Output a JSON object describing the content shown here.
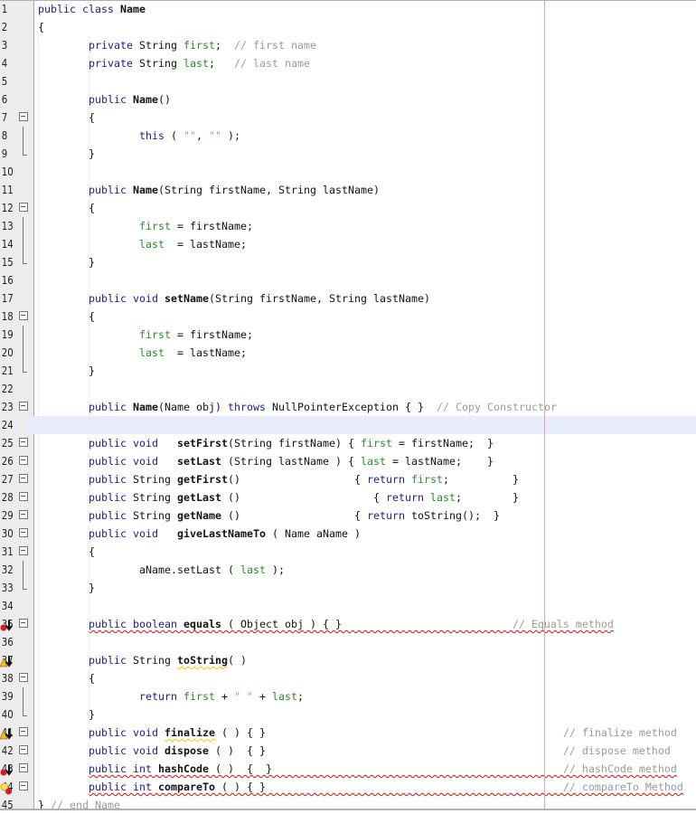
{
  "editor": {
    "current_line": 24,
    "colors": {
      "keyword": "#1c1c8a",
      "field": "#2a8a2a",
      "comment": "#9a9a9a",
      "string": "#c89a4a",
      "margin": "#f0a0a8",
      "current_line": "#e6edf8"
    },
    "lines": [
      {
        "n": "1",
        "tokens": [
          [
            "kw",
            "public class "
          ],
          [
            "bold",
            "Name"
          ]
        ]
      },
      {
        "n": "2",
        "tokens": [
          [
            "",
            "{"
          ]
        ]
      },
      {
        "n": "3",
        "tokens": [
          [
            "",
            "        "
          ],
          [
            "kw",
            "private "
          ],
          [
            "",
            "String "
          ],
          [
            "fld",
            "first"
          ],
          [
            "",
            ";  "
          ],
          [
            "cmt",
            "// first name"
          ]
        ]
      },
      {
        "n": "4",
        "tokens": [
          [
            "",
            "        "
          ],
          [
            "kw",
            "private "
          ],
          [
            "",
            "String "
          ],
          [
            "fld",
            "last"
          ],
          [
            "",
            ";   "
          ],
          [
            "cmt",
            "// last name"
          ]
        ]
      },
      {
        "n": "5",
        "tokens": []
      },
      {
        "n": "6",
        "tokens": [
          [
            "",
            "        "
          ],
          [
            "kw",
            "public "
          ],
          [
            "bold",
            "Name"
          ],
          [
            "",
            "()"
          ]
        ]
      },
      {
        "n": "7",
        "fold": "start",
        "tokens": [
          [
            "",
            "        {"
          ]
        ]
      },
      {
        "n": "8",
        "fold": "mid",
        "tokens": [
          [
            "",
            "                "
          ],
          [
            "kw",
            "this"
          ],
          [
            "",
            " ( "
          ],
          [
            "str",
            "\"\""
          ],
          [
            "",
            ", "
          ],
          [
            "str",
            "\"\""
          ],
          [
            "",
            " );"
          ]
        ]
      },
      {
        "n": "9",
        "fold": "end",
        "tokens": [
          [
            "",
            "        }"
          ]
        ]
      },
      {
        "n": "10",
        "tokens": []
      },
      {
        "n": "11",
        "tokens": [
          [
            "",
            "        "
          ],
          [
            "kw",
            "public "
          ],
          [
            "bold",
            "Name"
          ],
          [
            "",
            "(String firstName, String lastName)"
          ]
        ]
      },
      {
        "n": "12",
        "fold": "start",
        "tokens": [
          [
            "",
            "        {"
          ]
        ]
      },
      {
        "n": "13",
        "fold": "mid",
        "tokens": [
          [
            "",
            "                "
          ],
          [
            "fld",
            "first"
          ],
          [
            "",
            " = firstName;"
          ]
        ]
      },
      {
        "n": "14",
        "fold": "mid",
        "tokens": [
          [
            "",
            "                "
          ],
          [
            "fld",
            "last"
          ],
          [
            "",
            "  = lastName;"
          ]
        ]
      },
      {
        "n": "15",
        "fold": "end",
        "tokens": [
          [
            "",
            "        }"
          ]
        ]
      },
      {
        "n": "16",
        "tokens": []
      },
      {
        "n": "17",
        "tokens": [
          [
            "",
            "        "
          ],
          [
            "kw",
            "public void "
          ],
          [
            "bold",
            "setName"
          ],
          [
            "",
            "(String firstName, String lastName)"
          ]
        ]
      },
      {
        "n": "18",
        "fold": "start",
        "tokens": [
          [
            "",
            "        {"
          ]
        ]
      },
      {
        "n": "19",
        "fold": "mid",
        "tokens": [
          [
            "",
            "                "
          ],
          [
            "fld",
            "first"
          ],
          [
            "",
            " = firstName;"
          ]
        ]
      },
      {
        "n": "20",
        "fold": "mid",
        "tokens": [
          [
            "",
            "                "
          ],
          [
            "fld",
            "last"
          ],
          [
            "",
            "  = lastName;"
          ]
        ]
      },
      {
        "n": "21",
        "fold": "end",
        "tokens": [
          [
            "",
            "        }"
          ]
        ]
      },
      {
        "n": "22",
        "tokens": []
      },
      {
        "n": "23",
        "fold": "start",
        "tokens": [
          [
            "",
            "        "
          ],
          [
            "kw",
            "public "
          ],
          [
            "bold",
            "Name"
          ],
          [
            "",
            "(Name obj) "
          ],
          [
            "kw",
            "throws "
          ],
          [
            "",
            "NullPointerException { }  "
          ],
          [
            "cmt",
            "// Copy Constructor"
          ]
        ]
      },
      {
        "n": "24",
        "tokens": []
      },
      {
        "n": "25",
        "fold": "start",
        "tokens": [
          [
            "",
            "        "
          ],
          [
            "kw",
            "public void   "
          ],
          [
            "bold",
            "setFirst"
          ],
          [
            "",
            "(String firstName) { "
          ],
          [
            "fld",
            "first"
          ],
          [
            "",
            " = firstName;  }"
          ]
        ]
      },
      {
        "n": "26",
        "fold": "start",
        "tokens": [
          [
            "",
            "        "
          ],
          [
            "kw",
            "public void   "
          ],
          [
            "bold",
            "setLast"
          ],
          [
            "",
            " (String lastName ) { "
          ],
          [
            "fld",
            "last"
          ],
          [
            "",
            " = lastName;    }"
          ]
        ]
      },
      {
        "n": "27",
        "fold": "start",
        "tokens": [
          [
            "",
            "        "
          ],
          [
            "kw",
            "public "
          ],
          [
            "",
            "String "
          ],
          [
            "bold",
            "getFirst"
          ],
          [
            "",
            "()                  { "
          ],
          [
            "kw",
            "return "
          ],
          [
            "fld",
            "first"
          ],
          [
            "",
            ";          }"
          ]
        ]
      },
      {
        "n": "28",
        "fold": "start",
        "tokens": [
          [
            "",
            "        "
          ],
          [
            "kw",
            "public "
          ],
          [
            "",
            "String "
          ],
          [
            "bold",
            "getLast"
          ],
          [
            "",
            " ()                     { "
          ],
          [
            "kw",
            "return "
          ],
          [
            "fld",
            "last"
          ],
          [
            "",
            ";        }"
          ]
        ]
      },
      {
        "n": "29",
        "fold": "start",
        "tokens": [
          [
            "",
            "        "
          ],
          [
            "kw",
            "public "
          ],
          [
            "",
            "String "
          ],
          [
            "bold",
            "getName"
          ],
          [
            "",
            " ()                  { "
          ],
          [
            "kw",
            "return "
          ],
          [
            "",
            "toString();  }"
          ]
        ]
      },
      {
        "n": "30",
        "fold": "start",
        "tokens": [
          [
            "",
            "        "
          ],
          [
            "kw",
            "public void   "
          ],
          [
            "bold",
            "giveLastNameTo"
          ],
          [
            "",
            " ( Name aName )"
          ]
        ]
      },
      {
        "n": "31",
        "fold": "start",
        "tokens": [
          [
            "",
            "        {"
          ]
        ]
      },
      {
        "n": "32",
        "fold": "mid",
        "tokens": [
          [
            "",
            "                aName.setLast ( "
          ],
          [
            "fld",
            "last"
          ],
          [
            "",
            " );"
          ]
        ]
      },
      {
        "n": "33",
        "fold": "end",
        "tokens": [
          [
            "",
            "        }"
          ]
        ]
      },
      {
        "n": "34",
        "tokens": []
      },
      {
        "n": "35",
        "fold": "start",
        "marker": "error-override",
        "diag": "error",
        "indent": "        ",
        "tokens": [
          [
            "kw",
            "public boolean "
          ],
          [
            "bold",
            "equals"
          ],
          [
            "",
            " ( Object obj ) { }                           "
          ],
          [
            "cmt",
            "// Equals method"
          ]
        ]
      },
      {
        "n": "36",
        "tokens": []
      },
      {
        "n": "37",
        "marker": "warning-override",
        "tokens": [
          [
            "",
            "        "
          ],
          [
            "kw",
            "public "
          ],
          [
            "",
            "String "
          ],
          [
            "bold warn",
            "toString"
          ],
          [
            "",
            "( )"
          ]
        ]
      },
      {
        "n": "38",
        "fold": "start",
        "tokens": [
          [
            "",
            "        {"
          ]
        ]
      },
      {
        "n": "39",
        "fold": "mid",
        "tokens": [
          [
            "",
            "                "
          ],
          [
            "kw",
            "return "
          ],
          [
            "fld",
            "first"
          ],
          [
            "",
            " + "
          ],
          [
            "str",
            "\" \""
          ],
          [
            "",
            " + "
          ],
          [
            "fld",
            "last"
          ],
          [
            "",
            ";"
          ]
        ]
      },
      {
        "n": "40",
        "fold": "end",
        "tokens": [
          [
            "",
            "        }"
          ]
        ]
      },
      {
        "n": "41",
        "fold": "start",
        "marker": "warning-override",
        "tokens": [
          [
            "",
            "        "
          ],
          [
            "kw",
            "public void "
          ],
          [
            "bold warn",
            "finalize"
          ],
          [
            "",
            " ( ) { }                                               "
          ],
          [
            "cmt",
            "// finalize method"
          ]
        ]
      },
      {
        "n": "42",
        "fold": "start",
        "tokens": [
          [
            "",
            "        "
          ],
          [
            "kw",
            "public void "
          ],
          [
            "bold",
            "dispose"
          ],
          [
            "",
            " ( )  { }                                               "
          ],
          [
            "cmt",
            "// dispose method"
          ]
        ]
      },
      {
        "n": "43",
        "fold": "start",
        "marker": "error-override",
        "diag": "error",
        "indent": "        ",
        "tokens": [
          [
            "kw",
            "public int "
          ],
          [
            "bold",
            "hashCode"
          ],
          [
            "",
            " ( )  {  }                                              "
          ],
          [
            "cmt",
            "// hashCode method"
          ]
        ]
      },
      {
        "n": "44",
        "fold": "start",
        "marker": "bulb-error",
        "diag": "error",
        "indent": "        ",
        "tokens": [
          [
            "kw",
            "public int "
          ],
          [
            "bold",
            "compareTo"
          ],
          [
            "",
            " ( ) { }                                               "
          ],
          [
            "cmt",
            "// compareTo Method"
          ]
        ]
      },
      {
        "n": "45",
        "tokens": [
          [
            "",
            "} "
          ],
          [
            "cmt",
            "// end Name"
          ]
        ]
      }
    ]
  }
}
